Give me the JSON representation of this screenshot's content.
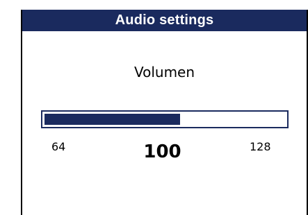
{
  "window": {
    "title": "Audio settings"
  },
  "volume": {
    "label": "Volumen",
    "min": "64",
    "max": "128",
    "current": "100",
    "min_value": 64,
    "max_value": 128,
    "current_value": 100
  },
  "colors": {
    "title_bar": "#1a2a5e",
    "bar_fill": "#1a2a5e"
  }
}
